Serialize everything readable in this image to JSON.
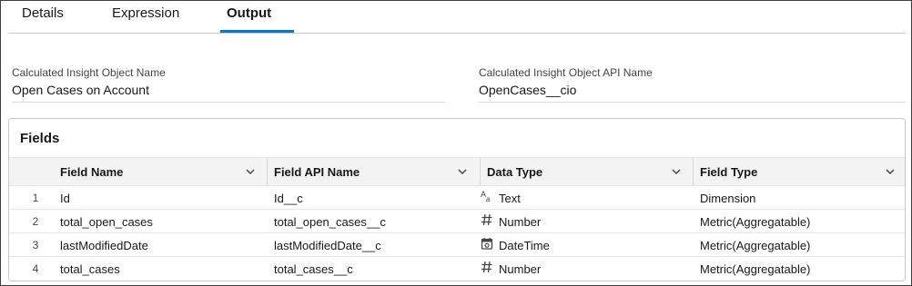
{
  "tabs": [
    {
      "label": "Details",
      "active": false
    },
    {
      "label": "Expression",
      "active": false
    },
    {
      "label": "Output",
      "active": true
    }
  ],
  "object_name": {
    "label": "Calculated Insight Object Name",
    "value": "Open Cases on Account"
  },
  "api_name": {
    "label": "Calculated Insight Object API Name",
    "value": "OpenCases__cio"
  },
  "fields_card": {
    "title": "Fields",
    "columns": [
      "Field Name",
      "Field API Name",
      "Data Type",
      "Field Type"
    ],
    "rows": [
      {
        "num": "1",
        "field_name": "Id",
        "api_name": "Id__c",
        "data_type": "Text",
        "data_type_icon": "text-icon",
        "field_type": "Dimension"
      },
      {
        "num": "2",
        "field_name": "total_open_cases",
        "api_name": "total_open_cases__c",
        "data_type": "Number",
        "data_type_icon": "number-icon",
        "field_type": "Metric(Aggregatable)"
      },
      {
        "num": "3",
        "field_name": "lastModifiedDate",
        "api_name": "lastModifiedDate__c",
        "data_type": "DateTime",
        "data_type_icon": "datetime-icon",
        "field_type": "Metric(Aggregatable)"
      },
      {
        "num": "4",
        "field_name": "total_cases",
        "api_name": "total_cases__c",
        "data_type": "Number",
        "data_type_icon": "number-icon",
        "field_type": "Metric(Aggregatable)"
      }
    ]
  },
  "colors": {
    "accent": "#0176d3",
    "header_bg": "#f3f3f3",
    "border": "#c9c9c9"
  }
}
